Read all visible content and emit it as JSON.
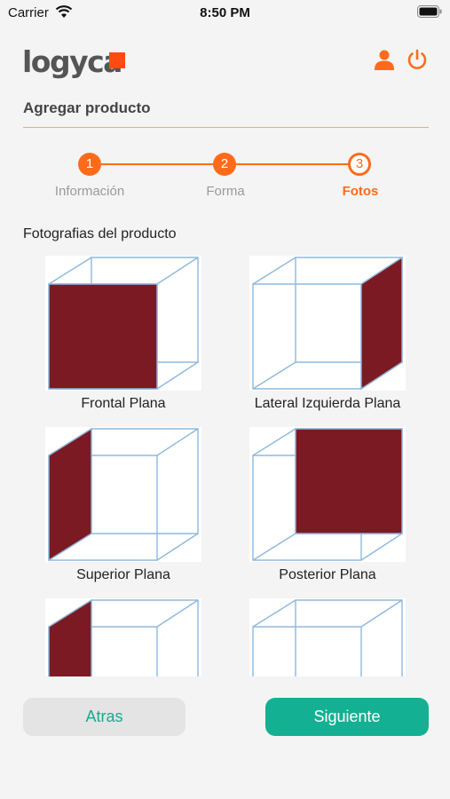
{
  "status_bar": {
    "carrier": "Carrier",
    "time": "8:50 PM"
  },
  "header": {
    "logo": "logyca",
    "user_icon": "user-icon",
    "power_icon": "power-icon"
  },
  "page": {
    "title": "Agregar producto"
  },
  "stepper": {
    "steps": [
      {
        "number": "1",
        "label": "Información",
        "state": "done"
      },
      {
        "number": "2",
        "label": "Forma",
        "state": "done"
      },
      {
        "number": "3",
        "label": "Fotos",
        "state": "current"
      }
    ]
  },
  "photos": {
    "section_title": "Fotografias del producto",
    "items": [
      {
        "label": "Frontal Plana",
        "highlight": "front"
      },
      {
        "label": "Lateral Izquierda Plana",
        "highlight": "right"
      },
      {
        "label": "Superior Plana",
        "highlight": "left"
      },
      {
        "label": "Posterior Plana",
        "highlight": "back"
      },
      {
        "label": "",
        "highlight": "left"
      },
      {
        "label": "",
        "highlight": "none"
      }
    ]
  },
  "buttons": {
    "back": "Atras",
    "next": "Siguiente"
  },
  "colors": {
    "accent": "#ff6b1a",
    "primary_button": "#14b093",
    "face_fill": "#7b1a22",
    "cube_edges": "#8fb8dd"
  }
}
